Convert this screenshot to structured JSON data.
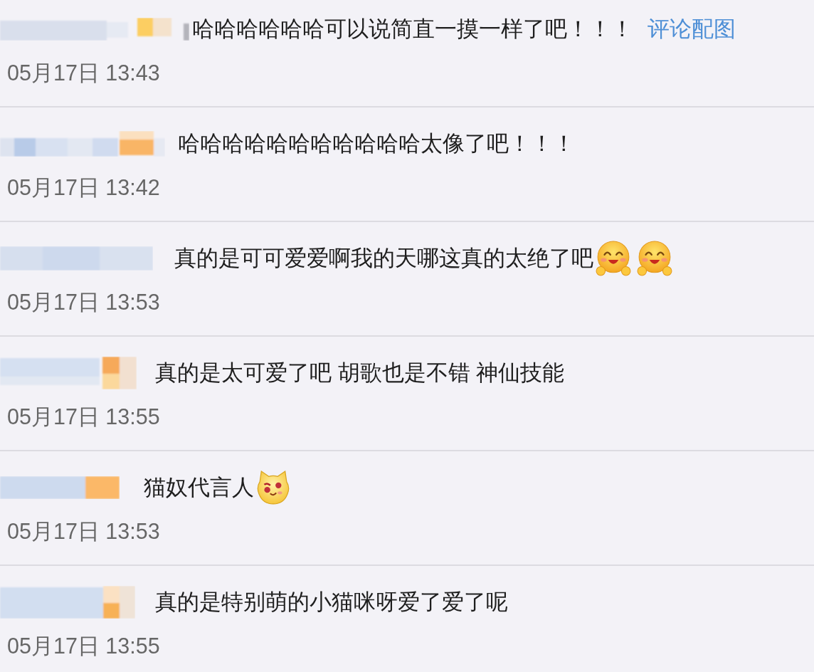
{
  "comments": [
    {
      "content": [
        {
          "kind": "text",
          "text": "哈哈哈哈哈哈可以说简直一摸一样了吧！！！"
        },
        {
          "kind": "link",
          "text": "评论配图"
        }
      ],
      "time": "05月17日 13:43"
    },
    {
      "content": [
        {
          "kind": "text",
          "text": "哈哈哈哈哈哈哈哈哈哈哈太像了吧！！！"
        }
      ],
      "time": "05月17日 13:42"
    },
    {
      "content": [
        {
          "kind": "text",
          "text": "真的是可可爱爱啊我的天哪这真的太绝了吧"
        },
        {
          "kind": "grin"
        },
        {
          "kind": "grin"
        }
      ],
      "time": "05月17日 13:53"
    },
    {
      "content": [
        {
          "kind": "text",
          "text": "真的是太可爱了吧 胡歌也是不错 神仙技能"
        }
      ],
      "time": "05月17日 13:55"
    },
    {
      "content": [
        {
          "kind": "text",
          "text": "猫奴代言人"
        },
        {
          "kind": "cat"
        }
      ],
      "time": "05月17日 13:53"
    },
    {
      "content": [
        {
          "kind": "text",
          "text": "真的是特别萌的小猫咪呀爱了爱了呢"
        }
      ],
      "time": "05月17日 13:55"
    }
  ]
}
